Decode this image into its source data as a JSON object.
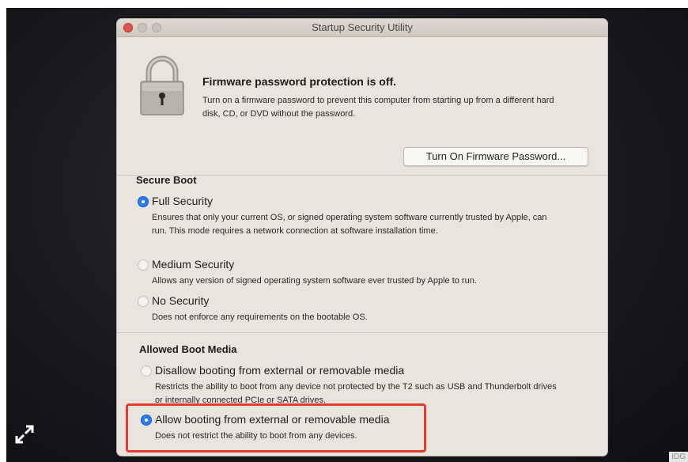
{
  "window": {
    "title": "Startup Security Utility"
  },
  "firmware": {
    "title": "Firmware password protection is off.",
    "description": "Turn on a firmware password to prevent this computer from starting up from a different hard disk, CD, or DVD without the password.",
    "button_label": "Turn On Firmware Password..."
  },
  "secure_boot": {
    "title": "Secure Boot",
    "options": [
      {
        "label": "Full Security",
        "selected": true,
        "description": "Ensures that only your current OS, or signed operating system software currently trusted by Apple, can run. This mode requires a network connection at software installation time."
      },
      {
        "label": "Medium Security",
        "selected": false,
        "description": "Allows any version of signed operating system software ever trusted by Apple to run."
      },
      {
        "label": "No Security",
        "selected": false,
        "description": "Does not enforce any requirements on the bootable OS."
      }
    ]
  },
  "boot_media": {
    "title": "Allowed Boot Media",
    "options": [
      {
        "label": "Disallow booting from external or removable media",
        "selected": false,
        "description": "Restricts the ability to boot from any device not protected by the T2 such as USB and Thunderbolt drives or internally connected PCIe or SATA drives."
      },
      {
        "label": "Allow booting from external or removable media",
        "selected": true,
        "description": "Does not restrict the ability to boot from any devices."
      }
    ]
  },
  "overlay": {
    "highlight_color": "#e43b2f",
    "expand_icon": "expand-arrows-icon",
    "watermark": "IDG"
  }
}
